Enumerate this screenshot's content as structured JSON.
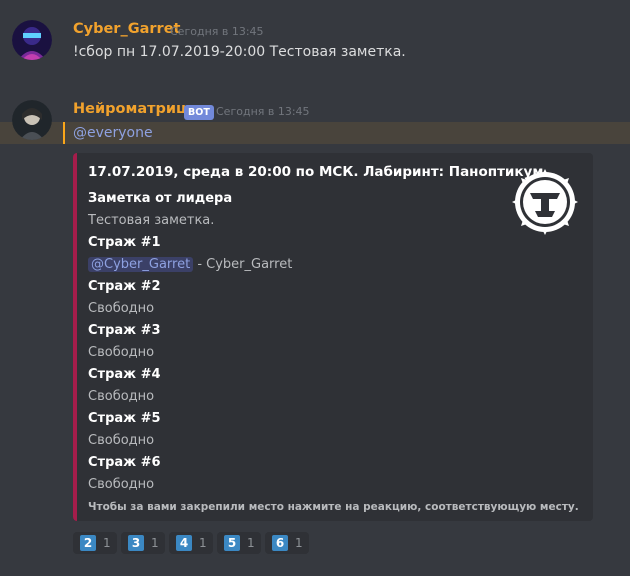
{
  "messages": [
    {
      "username": "Cyber_Garret",
      "timestamp": "Сегодня в 13:45",
      "text": "!сбор пн 17.07.2019-20:00 Тестовая заметка."
    },
    {
      "username": "Нейроматрица",
      "bot_badge": "BOT",
      "timestamp": "Сегодня в 13:45",
      "mention": "@everyone"
    }
  ],
  "embed": {
    "title": "17.07.2019, среда в 20:00 по МСК. Лабиринт: Паноптикум",
    "fields": [
      {
        "name": "Заметка от лидера",
        "value": "Тестовая заметка."
      },
      {
        "name": "Страж #1",
        "value_mention": "@Cyber_Garret",
        "value": " - Cyber_Garret"
      },
      {
        "name": "Страж #2",
        "value": "Свободно"
      },
      {
        "name": "Страж #3",
        "value": "Свободно"
      },
      {
        "name": "Страж #4",
        "value": "Свободно"
      },
      {
        "name": "Страж #5",
        "value": "Свободно"
      },
      {
        "name": "Страж #6",
        "value": "Свободно"
      }
    ],
    "footer": "Чтобы за вами закрепили место нажмите на реакцию, соответствующую месту."
  },
  "reactions": [
    {
      "emoji": "2",
      "count": "1"
    },
    {
      "emoji": "3",
      "count": "1"
    },
    {
      "emoji": "4",
      "count": "1"
    },
    {
      "emoji": "5",
      "count": "1"
    },
    {
      "emoji": "6",
      "count": "1"
    }
  ],
  "colors": {
    "background": "#36393f",
    "username": "#f1a22d",
    "embed_stripe": "#a51d4b",
    "mention": "#8ea1e1",
    "reaction_key": "#3b88c3"
  },
  "icons": [
    "avatar-cyber-garret",
    "avatar-neuromatrix",
    "embed-thumbnail-emblem",
    "keycap-digit-emoji"
  ]
}
